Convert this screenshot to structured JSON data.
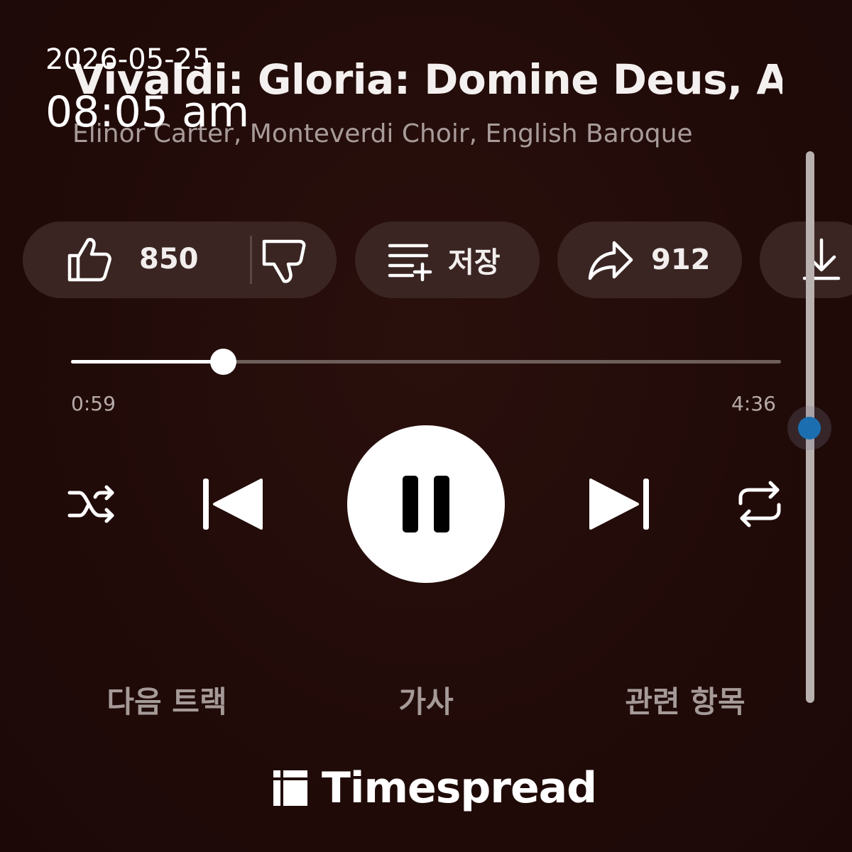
{
  "overlay": {
    "date": "2026-05-25",
    "time": "08:05 am"
  },
  "track": {
    "title": "Vivaldi: Gloria: Domine Deus, Agnus Dei",
    "artist": "Elinor Carter, Monteverdi Choir, English Baroque"
  },
  "actions": {
    "like_count": "850",
    "save_label": "저장",
    "share_count": "912"
  },
  "playback": {
    "elapsed": "0:59",
    "duration": "4:36",
    "progress_fraction": 0.214,
    "state": "playing"
  },
  "tabs": {
    "up_next": "다음 트랙",
    "lyrics": "가사",
    "related": "관련 항목"
  },
  "scrollbar": {
    "position_fraction": 0.5
  },
  "brand": {
    "name": "Timespread"
  },
  "icons": {
    "like": "thumbs-up-icon",
    "dislike": "thumbs-down-icon",
    "save": "playlist-add-icon",
    "share": "share-arrow-icon",
    "download": "download-icon",
    "shuffle": "shuffle-icon",
    "previous": "skip-previous-icon",
    "pause": "pause-icon",
    "next": "skip-next-icon",
    "repeat": "repeat-icon"
  },
  "colors": {
    "background": "#200b09",
    "pill": "#3a2523",
    "accent_blue": "#1b6fb0"
  }
}
